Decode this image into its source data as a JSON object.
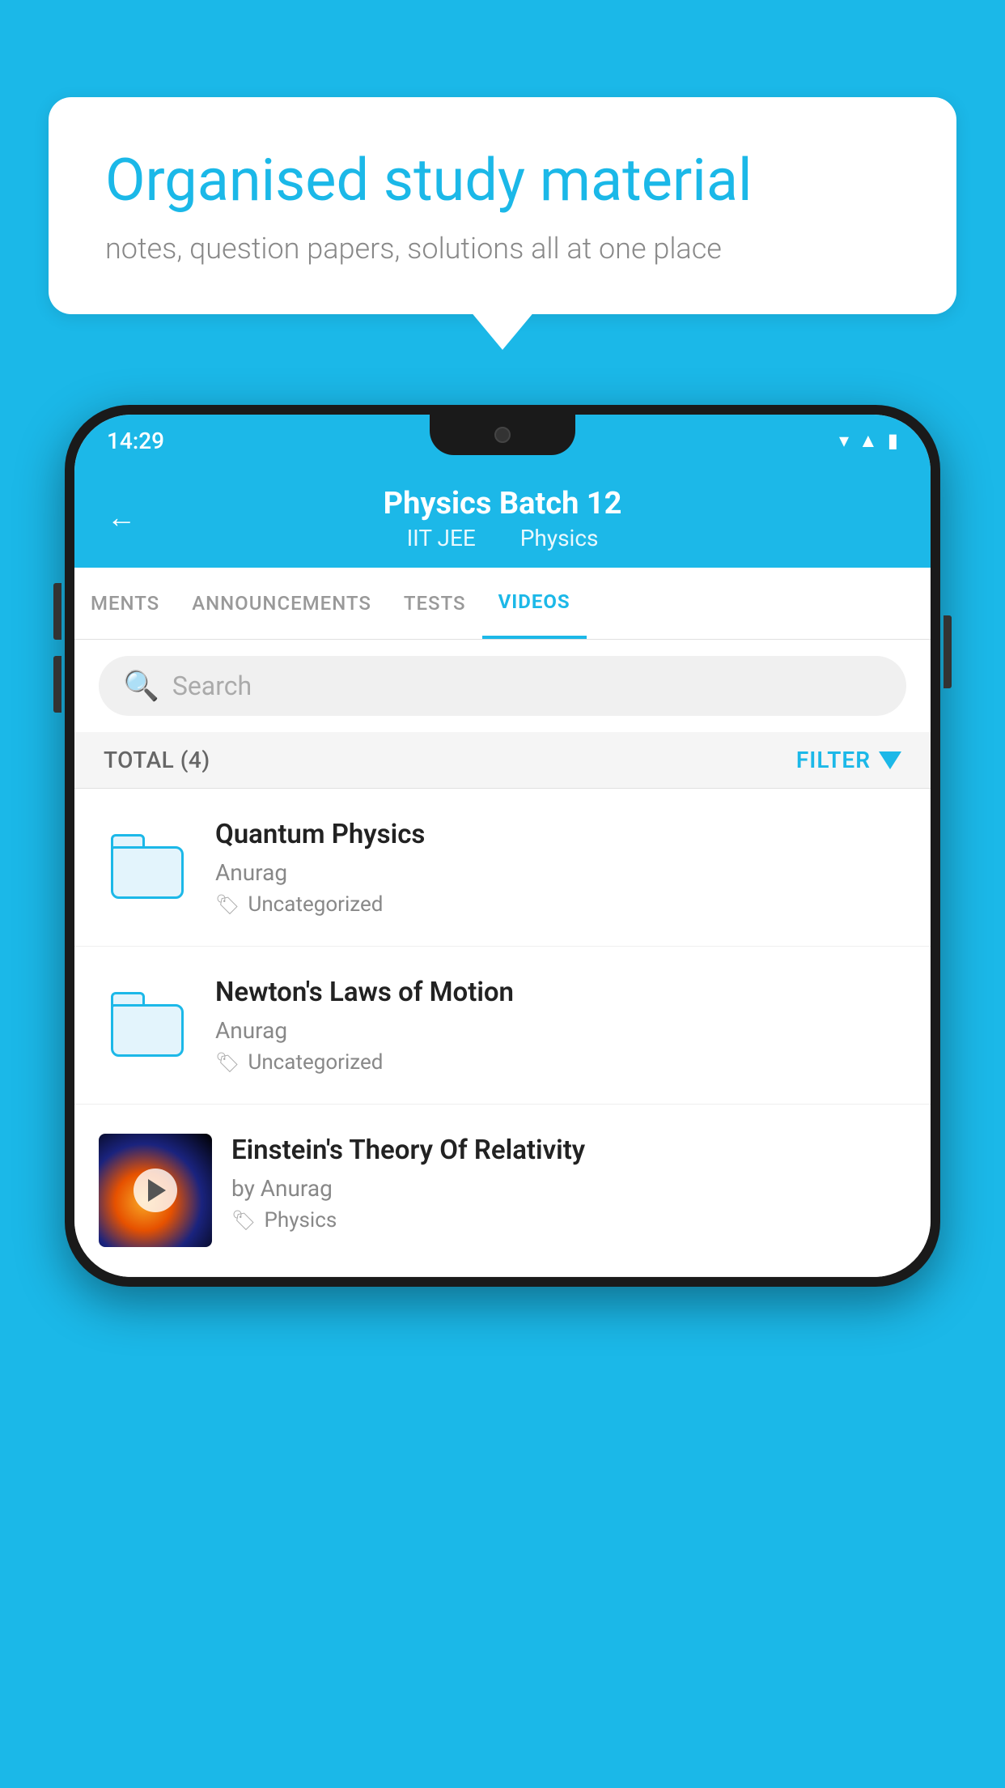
{
  "hero": {
    "title": "Organised study material",
    "subtitle": "notes, question papers, solutions all at one place"
  },
  "phone": {
    "status_time": "14:29",
    "header": {
      "title": "Physics Batch 12",
      "subtitle_left": "IIT JEE",
      "subtitle_right": "Physics"
    },
    "tabs": [
      {
        "label": "MENTS",
        "active": false
      },
      {
        "label": "ANNOUNCEMENTS",
        "active": false
      },
      {
        "label": "TESTS",
        "active": false
      },
      {
        "label": "VIDEOS",
        "active": true
      }
    ],
    "search": {
      "placeholder": "Search"
    },
    "filter": {
      "total_label": "TOTAL (4)",
      "filter_label": "FILTER"
    },
    "videos": [
      {
        "title": "Quantum Physics",
        "author": "Anurag",
        "tag": "Uncategorized",
        "has_thumbnail": false
      },
      {
        "title": "Newton's Laws of Motion",
        "author": "Anurag",
        "tag": "Uncategorized",
        "has_thumbnail": false
      },
      {
        "title": "Einstein's Theory Of Relativity",
        "author": "by Anurag",
        "tag": "Physics",
        "has_thumbnail": true
      }
    ]
  }
}
